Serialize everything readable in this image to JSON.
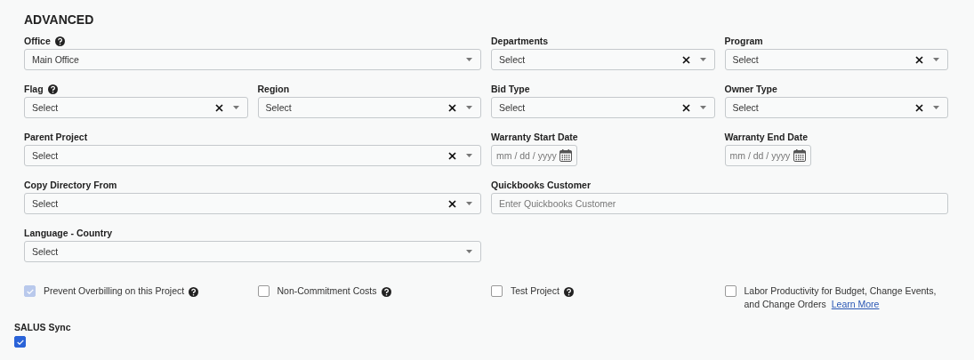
{
  "section": {
    "title": "ADVANCED"
  },
  "rows": [
    {
      "fields": [
        {
          "label": "Office",
          "help": true,
          "kind": "select",
          "value": "Main Office",
          "clearable": false
        },
        {
          "label": "Departments",
          "help": false,
          "kind": "select",
          "placeholder": "Select",
          "clearable": true
        },
        {
          "label": "Program",
          "help": false,
          "kind": "select",
          "placeholder": "Select",
          "clearable": true
        }
      ]
    },
    {
      "fields": [
        {
          "label": "Flag",
          "help": true,
          "kind": "select",
          "placeholder": "Select",
          "clearable": true
        },
        {
          "label": "Region",
          "help": false,
          "kind": "select",
          "placeholder": "Select",
          "clearable": true
        },
        {
          "label": "Bid Type",
          "help": false,
          "kind": "select",
          "placeholder": "Select",
          "clearable": true
        },
        {
          "label": "Owner Type",
          "help": false,
          "kind": "select",
          "placeholder": "Select",
          "clearable": true
        }
      ]
    },
    {
      "fields": [
        {
          "label": "Parent Project",
          "help": false,
          "kind": "select",
          "placeholder": "Select",
          "clearable": true
        },
        {
          "label": "Warranty Start Date",
          "help": false,
          "kind": "date",
          "placeholder": "mm / dd / yyyy"
        },
        {
          "label": "Warranty End Date",
          "help": false,
          "kind": "date",
          "placeholder": "mm / dd / yyyy"
        }
      ]
    },
    {
      "fields": [
        {
          "label": "Copy Directory From",
          "help": false,
          "kind": "select",
          "placeholder": "Select",
          "clearable": true
        },
        {
          "label": "Quickbooks Customer",
          "help": false,
          "kind": "text",
          "placeholder": "Enter Quickbooks Customer"
        }
      ]
    },
    {
      "fields": [
        {
          "label": "Language - Country",
          "help": false,
          "kind": "select",
          "placeholder": "Select",
          "clearable": false
        }
      ]
    }
  ],
  "options": [
    {
      "label": "Prevent Overbilling on this Project",
      "checked": true,
      "disabled": true,
      "help": true
    },
    {
      "label": "Non-Commitment Costs",
      "checked": false,
      "disabled": false,
      "help": true
    },
    {
      "label": "Test Project",
      "checked": false,
      "disabled": false,
      "help": true
    },
    {
      "label": "Labor Productivity for Budget, Change Events, and Change Orders",
      "checked": false,
      "disabled": false,
      "help": false,
      "link": "Learn More"
    }
  ],
  "salus_sync": {
    "label": "SALUS Sync",
    "checked": true
  }
}
